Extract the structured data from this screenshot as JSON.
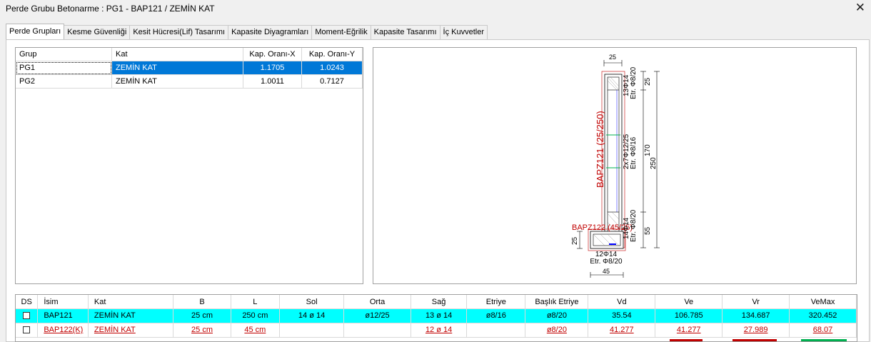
{
  "window": {
    "title": "Perde Grubu Betonarme  :  PG1 - BAP121 / ZEMİN KAT",
    "close_icon": "close-icon"
  },
  "tabs": [
    "Perde Grupları",
    "Kesme Güvenliği",
    "Kesit Hücresi(Lif) Tasarımı",
    "Kapasite Diyagramları",
    "Moment-Eğrilik",
    "Kapasite Tasarımı",
    "İç Kuvvetler"
  ],
  "group_table": {
    "columns": [
      "Grup",
      "Kat",
      "Kap. Oranı-X",
      "Kap. Oranı-Y"
    ],
    "rows": [
      {
        "grup": "PG1",
        "kat": "ZEMİN KAT",
        "kx": "1.1705",
        "ky": "1.0243",
        "selected": true
      },
      {
        "grup": "PG2",
        "kat": "ZEMİN KAT",
        "kx": "1.0011",
        "ky": "0.7127",
        "selected": false
      }
    ]
  },
  "drawing": {
    "dim_top": "25",
    "dim_bottom": "45",
    "dim_left_small": "25",
    "dim_right_top": "25",
    "dim_right_mid": "170",
    "dim_right_bot": "55",
    "dim_right_total": "250",
    "label_main": "BAPZ121 (25/250)",
    "label_side": "BAPZ122 (45/25)",
    "rebar_top_1": "13Φ14",
    "rebar_top_2": "Etr. Φ8/20",
    "rebar_mid_1": "2x7Φ12/25",
    "rebar_mid_2": "Etr. Φ8/16",
    "rebar_bot_1": "14Φ14",
    "rebar_bot_2": "Etr. Φ8/20",
    "rebar_foot_1": "12Φ14",
    "rebar_foot_2": "Etr. Φ8/20",
    "colors": {
      "red": "#c00000",
      "green": "#00b050",
      "blue": "#0000ff"
    }
  },
  "wall_table": {
    "columns": [
      "DS",
      "İsim",
      "Kat",
      "B",
      "L",
      "Sol",
      "Orta",
      "Sağ",
      "Etriye",
      "Başlık Etriye",
      "Vd",
      "Ve",
      "Vr",
      "VeMax"
    ],
    "rows": [
      {
        "isim": "BAP121",
        "kat": "ZEMİN KAT",
        "b": "25 cm",
        "l": "250 cm",
        "sol": "14 ø 14",
        "orta": "ø12/25",
        "sag": "13 ø 14",
        "etriye": "ø8/16",
        "baslik": "ø8/20",
        "vd": "35.54",
        "ve": "106.785",
        "vr": "134.687",
        "vemax": "320.452",
        "style": "cyan"
      },
      {
        "isim": "BAP122(K)",
        "kat": "ZEMİN KAT",
        "b": "25 cm",
        "l": "45 cm",
        "sol": "",
        "orta": "",
        "sag": "12 ø 14",
        "etriye": "",
        "baslik": "ø8/20",
        "vd": "41.277",
        "ve": "41.277",
        "vr": "27.989",
        "vemax": "68.07",
        "style": "red"
      }
    ]
  }
}
